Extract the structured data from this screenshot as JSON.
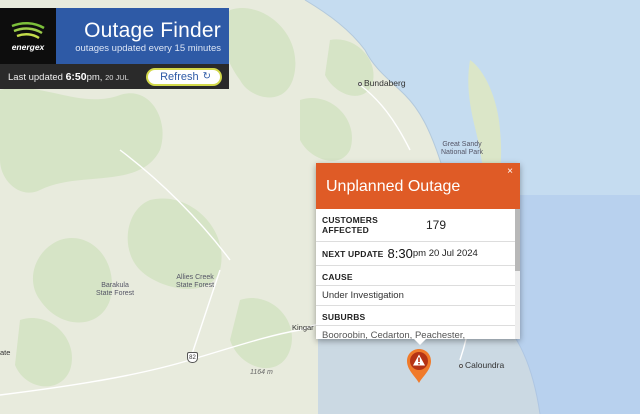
{
  "map": {
    "labels": {
      "bundaberg": "Bundaberg",
      "great_sandy": "Great Sandy\nNational Park",
      "barakula": "Barakula\nState Forest",
      "allies_creek": "Allies Creek\nState Forest",
      "kingaroy": "Kingar",
      "caloundra": "Caloundra",
      "elevation": "1164 m",
      "route": "82",
      "left_edge": "ate"
    }
  },
  "finder": {
    "brand": "energex",
    "title": "Outage Finder",
    "subtitle": "outages updated every 15 minutes",
    "updated_prefix": "Last updated",
    "updated_time": "6:50",
    "updated_ampm": "pm,",
    "updated_date": "20 JUL",
    "refresh_label": "Refresh",
    "refresh_icon": "↻"
  },
  "popup": {
    "title": "Unplanned Outage",
    "close_icon": "×",
    "customers_label": "CUSTOMERS AFFECTED",
    "customers_value": "179",
    "next_update_label": "NEXT UPDATE",
    "next_update_time": "8:30",
    "next_update_rest": "pm 20 Jul 2024",
    "cause_label": "CAUSE",
    "cause_value": "Under Investigation",
    "suburbs_label": "SUBURBS",
    "suburbs_value": "Booroobin, Cedarton, Peachester,",
    "scroll_position": 0
  },
  "colors": {
    "brand_blue": "#2e5aa6",
    "popup_orange": "#df5b26",
    "refresh_border": "#d3d94a",
    "marker": "#f07a2a"
  },
  "marker": {
    "icon": "warning-icon"
  }
}
